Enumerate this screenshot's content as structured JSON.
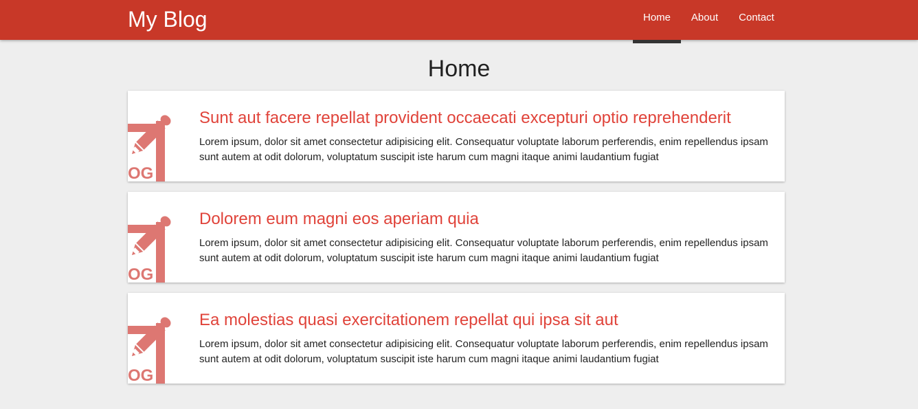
{
  "header": {
    "brand": "My Blog",
    "nav": [
      {
        "label": "Home",
        "active": true
      },
      {
        "label": "About",
        "active": false
      },
      {
        "label": "Contact",
        "active": false
      }
    ]
  },
  "page": {
    "title": "Home"
  },
  "posts": [
    {
      "title": "Sunt aut facere repellat provident occaecati excepturi optio reprehenderit",
      "excerpt": "Lorem ipsum, dolor sit amet consectetur adipisicing elit. Consequatur voluptate laborum perferendis, enim repellendus ipsam sunt autem at odit dolorum, voluptatum suscipit iste harum cum magni itaque animi laudantium fugiat",
      "thumbnail_icon": "blog-pencil-icon",
      "thumbnail_text": "OG"
    },
    {
      "title": "Dolorem eum magni eos aperiam quia",
      "excerpt": "Lorem ipsum, dolor sit amet consectetur adipisicing elit. Consequatur voluptate laborum perferendis, enim repellendus ipsam sunt autem at odit dolorum, voluptatum suscipit iste harum cum magni itaque animi laudantium fugiat",
      "thumbnail_icon": "blog-pencil-icon",
      "thumbnail_text": "OG"
    },
    {
      "title": "Ea molestias quasi exercitationem repellat qui ipsa sit aut",
      "excerpt": "Lorem ipsum, dolor sit amet consectetur adipisicing elit. Consequatur voluptate laborum perferendis, enim repellendus ipsam sunt autem at odit dolorum, voluptatum suscipit iste harum cum magni itaque animi laudantium fugiat",
      "thumbnail_icon": "blog-pencil-icon",
      "thumbnail_text": "OG"
    }
  ],
  "colors": {
    "navbar": "#c83828",
    "post_title": "#e0433a",
    "thumbnail": "#dd7772",
    "active_indicator": "#333333",
    "background": "#eeeeee"
  }
}
